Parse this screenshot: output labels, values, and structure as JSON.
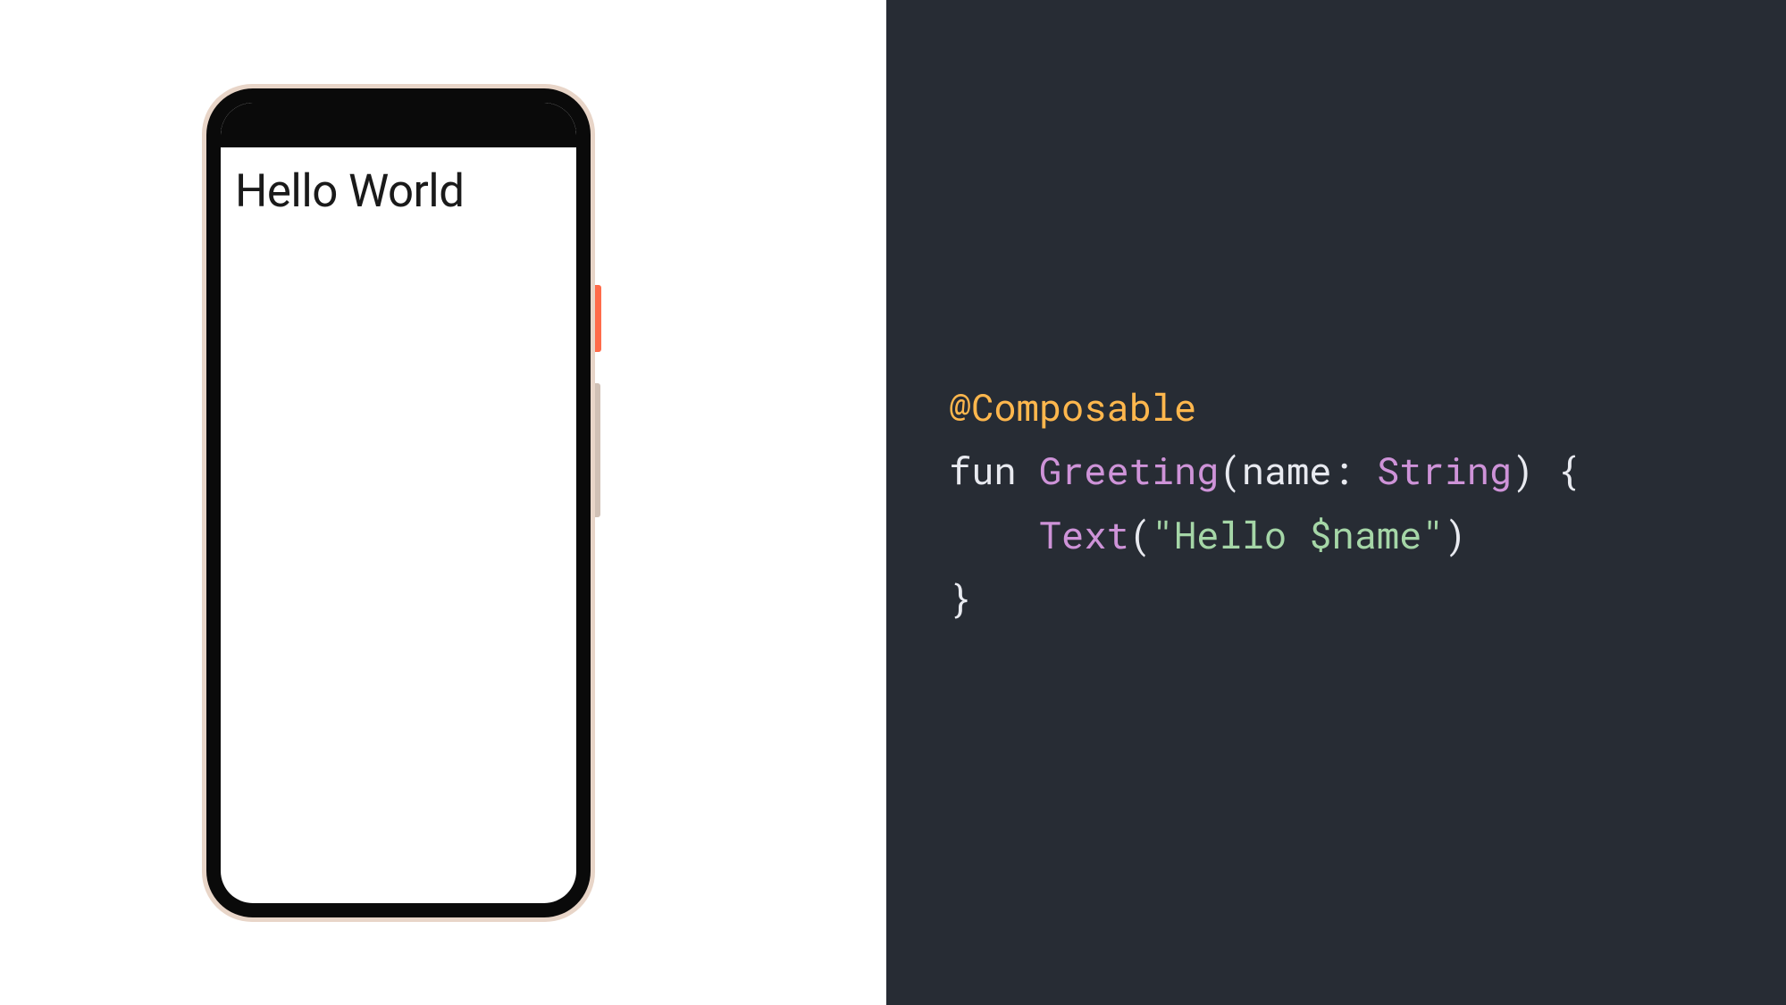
{
  "preview": {
    "greeting_text": "Hello World"
  },
  "code": {
    "annotation": "@Composable",
    "keyword_fun": "fun ",
    "function_name": "Greeting",
    "paren_open": "(",
    "param_name": "name",
    "colon": ": ",
    "type": "String",
    "paren_close": ")",
    "brace_open": " {",
    "indent": "    ",
    "call": "Text",
    "call_paren_open": "(",
    "string_literal": "\"Hello $name\"",
    "call_paren_close": ")",
    "brace_close": "}"
  },
  "colors": {
    "code_bg": "#272c34",
    "annotation": "#ffb74d",
    "function": "#ce93d8",
    "string": "#a5d6a7",
    "text": "#e8eaf0",
    "accent_button": "#ff6b4a"
  }
}
